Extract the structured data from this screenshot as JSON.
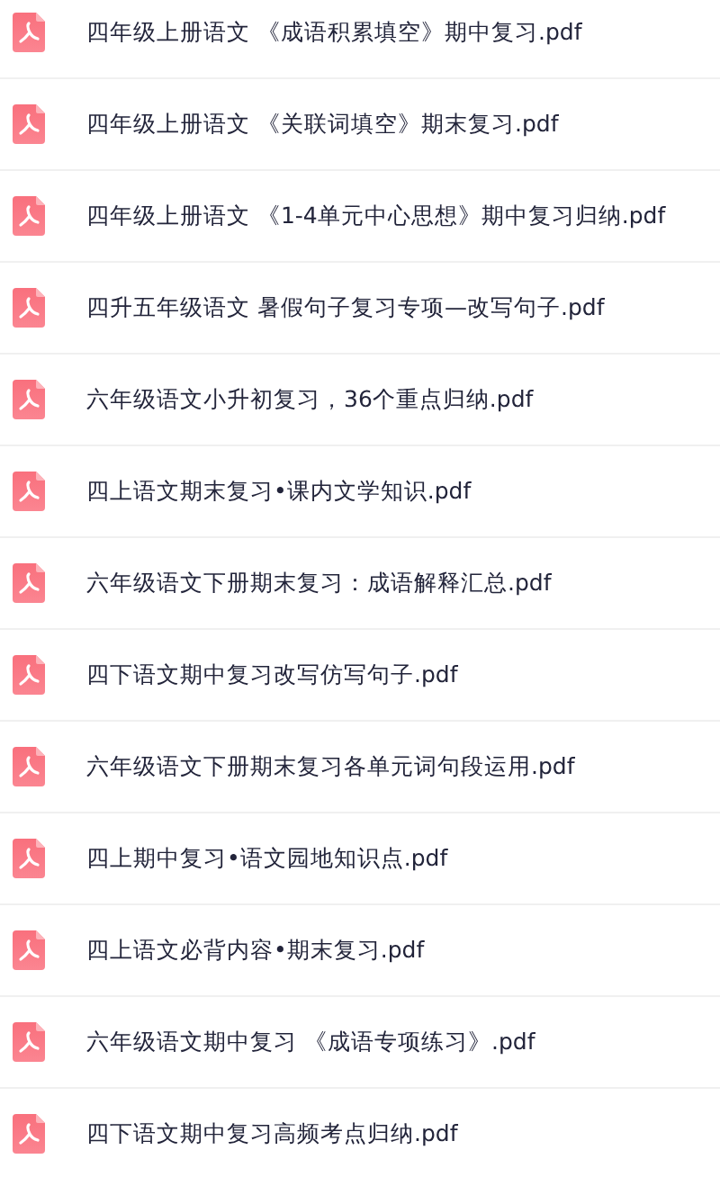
{
  "files": [
    {
      "name": "四年级上册语文 《成语积累填空》期中复习.pdf"
    },
    {
      "name": "四年级上册语文 《关联词填空》期末复习.pdf"
    },
    {
      "name": "四年级上册语文 《1-4单元中心思想》期中复习归纳.pdf"
    },
    {
      "name": "四升五年级语文 暑假句子复习专项—改写句子.pdf"
    },
    {
      "name": "六年级语文小升初复习，36个重点归纳.pdf"
    },
    {
      "name": "四上语文期末复习•课内文学知识.pdf"
    },
    {
      "name": "六年级语文下册期末复习：成语解释汇总.pdf"
    },
    {
      "name": "四下语文期中复习改写仿写句子.pdf"
    },
    {
      "name": "六年级语文下册期末复习各单元词句段运用.pdf"
    },
    {
      "name": "四上期中复习•语文园地知识点.pdf"
    },
    {
      "name": "四上语文必背内容•期末复习.pdf"
    },
    {
      "name": "六年级语文期中复习 《成语专项练习》.pdf"
    },
    {
      "name": "四下语文期中复习高频考点归纳.pdf"
    }
  ]
}
